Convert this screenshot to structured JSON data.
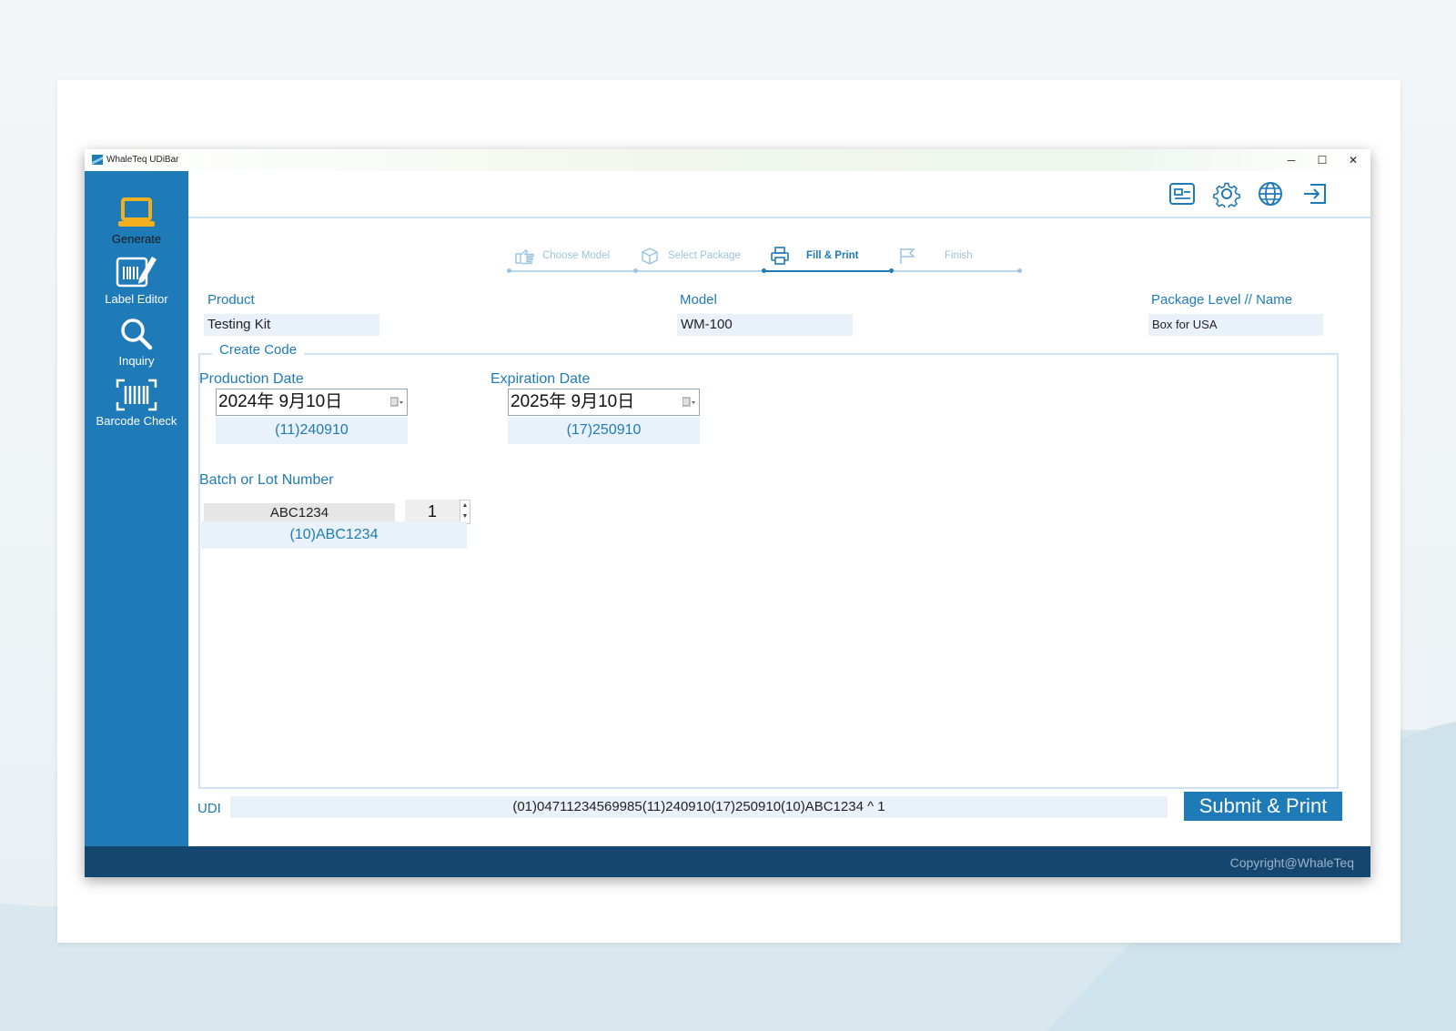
{
  "app": {
    "title": "WhaleTeq UDiBar"
  },
  "window_controls": {
    "minimize": "─",
    "maximize": "☐",
    "close": "✕"
  },
  "sidebar": {
    "items": [
      {
        "label": "Generate",
        "icon": "laptop-icon"
      },
      {
        "label": "Label Editor",
        "icon": "barcode-edit-icon"
      },
      {
        "label": "Inquiry",
        "icon": "search-icon"
      },
      {
        "label": "Barcode Check",
        "icon": "barcode-scan-icon"
      }
    ]
  },
  "toolbar": {
    "icons": [
      "id-card-icon",
      "gear-icon",
      "globe-icon",
      "logout-icon"
    ]
  },
  "steps": [
    {
      "label": "Choose Model",
      "icon": "hand-point-icon"
    },
    {
      "label": "Select Package",
      "icon": "package-icon"
    },
    {
      "label": "Fill & Print",
      "icon": "printer-icon",
      "active": true
    },
    {
      "label": "Finish",
      "icon": "flag-icon"
    }
  ],
  "product": {
    "label": "Product",
    "value": "Testing Kit"
  },
  "model": {
    "label": "Model",
    "value": "WM-100"
  },
  "package": {
    "label": "Package Level // Name",
    "value": "Box for USA"
  },
  "create_code": {
    "title": "Create Code",
    "production": {
      "label": "Production Date",
      "value": "2024年  9月10日",
      "code": "(11)240910"
    },
    "expiration": {
      "label": "Expiration Date",
      "value": "2025年  9月10日",
      "code": "(17)250910"
    },
    "batch": {
      "label": "Batch or Lot Number",
      "value": "ABC1234",
      "qty": "1",
      "code": "(10)ABC1234"
    }
  },
  "udi": {
    "label": "UDI",
    "value": "(01)04711234569985(11)240910(17)250910(10)ABC1234 ^ 1"
  },
  "submit_label": "Submit & Print",
  "footer": {
    "copyright": "Copyright@WhaleTeq"
  },
  "colors": {
    "primary": "#1f7ab8",
    "footer": "#15466f",
    "field_bg": "#e9f2fb",
    "active_nav_icon": "#f2b01e"
  }
}
